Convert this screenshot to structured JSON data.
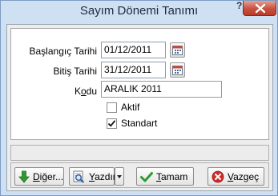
{
  "window": {
    "title": "Sayım Dönemi Tanımı",
    "help": "?"
  },
  "form": {
    "start_date": {
      "label": "Başlangıç Tarihi",
      "value": "01/12/2011"
    },
    "end_date": {
      "label": "Bitiş Tarihi",
      "value": "31/12/2011"
    },
    "code": {
      "label_prefix": "K",
      "label_underlined": "o",
      "label_suffix": "du",
      "value": "ARALIK 2011"
    },
    "aktif": {
      "label": "Aktif",
      "checked": false
    },
    "standart": {
      "label": "Standart",
      "checked": true
    }
  },
  "buttons": {
    "other": {
      "underlined": "D",
      "rest": "iğer..."
    },
    "print": {
      "underlined": "Y",
      "rest": "azdır"
    },
    "ok": {
      "underlined": "T",
      "rest": "amam"
    },
    "cancel": {
      "underlined": "V",
      "rest": "azgeç"
    }
  },
  "colors": {
    "title_bg": "#cfe0f3",
    "close_red": "#c7513f",
    "green_arrow": "#2e9a2e",
    "ok_check": "#2d9b2d",
    "cancel_red": "#d22b2b"
  },
  "icons": {
    "help": "help-icon",
    "close": "close-icon",
    "calendar": "calendar-icon",
    "arrow_down": "arrow-down-icon",
    "print_search": "print-preview-icon",
    "check": "check-icon",
    "cancel": "cancel-icon"
  }
}
